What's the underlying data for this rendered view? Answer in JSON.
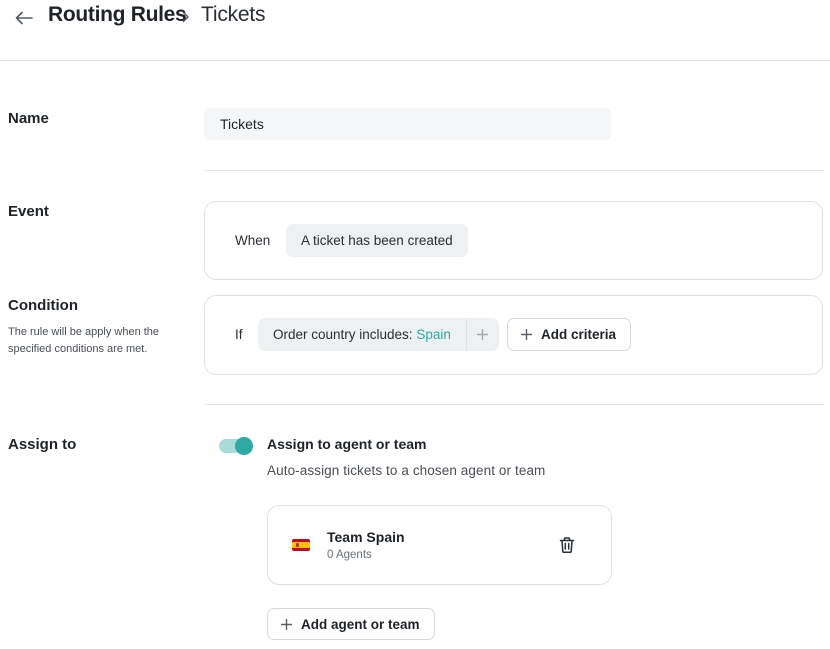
{
  "header": {
    "title": "Routing Rules",
    "current": "Tickets"
  },
  "name_section": {
    "label": "Name",
    "value": "Tickets"
  },
  "event_section": {
    "label": "Event",
    "when_label": "When",
    "event_value": "A ticket has been created"
  },
  "condition_section": {
    "label": "Condition",
    "hint": "The rule will be apply when the specified conditions are met.",
    "if_label": "If",
    "criteria_prefix": "Order country includes: ",
    "criteria_value": "Spain",
    "add_criteria_label": "Add criteria"
  },
  "assign_section": {
    "label": "Assign to",
    "toggle_on": true,
    "title": "Assign to agent or team",
    "description": "Auto-assign tickets to a chosen agent or team",
    "team": {
      "name": "Team Spain",
      "agents": "0 Agents"
    },
    "add_label": "Add agent or team"
  },
  "colors": {
    "accent": "#2ea9a4",
    "accent_light": "#a9dcd9",
    "pill_bg": "#eef1f2",
    "input_bg": "#f4f6f7",
    "border": "#dfe2e5"
  },
  "icons": {
    "back": "arrow-left-icon",
    "separator": "chevron-right-icon",
    "plus": "plus-icon",
    "delete": "trash-icon",
    "flag": "spain-flag-icon"
  }
}
